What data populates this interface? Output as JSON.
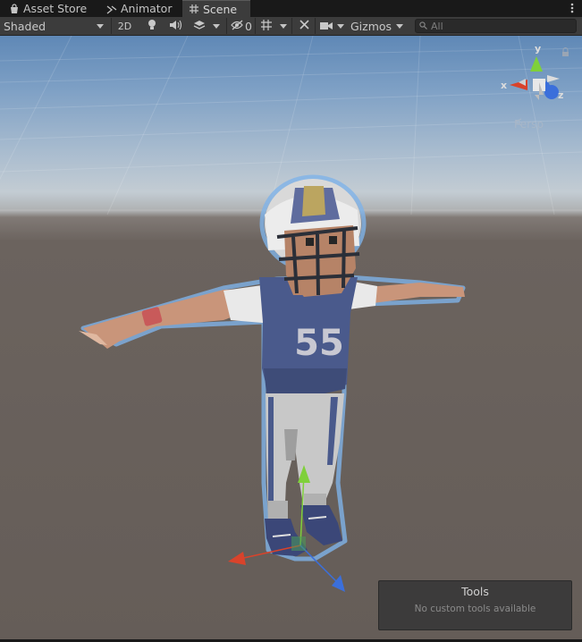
{
  "tabs": [
    {
      "label": "Asset Store",
      "icon": "shopping-bag-icon"
    },
    {
      "label": "Animator",
      "icon": "animator-icon"
    },
    {
      "label": "Scene",
      "icon": "grid-icon",
      "active": true
    }
  ],
  "toolbar": {
    "shading_mode": "Shaded",
    "mode_2d": "2D",
    "hidden_count": "0",
    "gizmos_label": "Gizmos",
    "search_placeholder": "All"
  },
  "viewport": {
    "projection_label": "Persp",
    "axis_labels": {
      "x": "x",
      "y": "y",
      "z": "z"
    },
    "character_number": "55"
  },
  "tools_overlay": {
    "title": "Tools",
    "message": "No custom tools available"
  },
  "colors": {
    "accent_x": "#d9432b",
    "accent_y": "#7fd03a",
    "accent_z": "#3b6fdb",
    "selection_outline": "#7fb3e8",
    "jersey": "#4a5a8c"
  }
}
